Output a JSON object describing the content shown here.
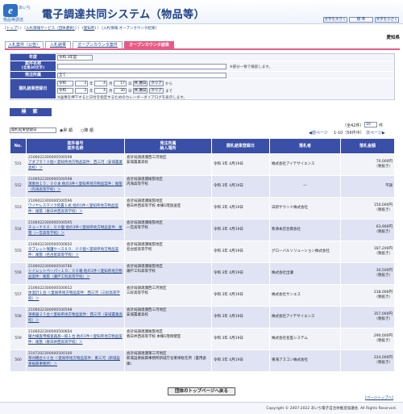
{
  "header": {
    "logo_letter": "e",
    "logo_small": "あいち",
    "logo_sub": "物品等調達",
    "title": "電子調達共同システム（物品等）",
    "btn_font_large": "文字を大きく",
    "btn_font_std": "標 準",
    "btn_font_small": "文字を小さく"
  },
  "breadcrumb": {
    "items": [
      "トップ",
      "入札情報サービス（団体選択）",
      "愛知県"
    ],
    "current": "入札情報:オープンカウンタ結果",
    "sep": "〉"
  },
  "org_name": "愛知県",
  "tabs": [
    "入札案件（公告）",
    "入札結果",
    "オープンカウンタ案件",
    "オープンカウンタ結果"
  ],
  "form": {
    "fiscal_year_label": "年度",
    "fiscal_year_value": "令和 3年度",
    "case_name_label": "案件名称",
    "case_name_sub": "(全角30文字)",
    "case_name_note": "※部分一致で検索します。",
    "order_org_label": "発注所属",
    "order_org_value": "全て",
    "date_label": "開札結果登録日",
    "era1": "令和",
    "from_y": "3",
    "from_m": "4",
    "from_d": "17",
    "to_y": "3",
    "to_m": "4",
    "to_d": "30",
    "unit_y": "年",
    "unit_m": "月",
    "unit_d": "日",
    "calendar": "共 暦日",
    "clear": "クリア",
    "from_suffix": "から",
    "to_suffix": "まで",
    "date_note": "※画像を押下すると日付を指定するためのカレンダーダイアログを表示します。"
  },
  "search_button": "検 索",
  "sort": {
    "select": "開札結果登録日",
    "asc": "昇 順",
    "desc": "降 順"
  },
  "paging": {
    "prev": "前ページ",
    "info": "（56件中）",
    "range": "1-10",
    "next": "次ページ",
    "per_page_label": "（全42件）",
    "per_page_value": "10",
    "per_page_unit": "件"
  },
  "table": {
    "headers": [
      "No.",
      "案件番号\n案件名称",
      "発注所属\n納入場所",
      "開札結果登録日",
      "落札者",
      "落札金額"
    ],
    "rows": [
      {
        "no": "551",
        "case_no": "2106022300000500598",
        "case_name": "アダプタ７０個＜愛知県地方物品案件：西三河（安城農業高校）＞",
        "org": "会計局調達課西三河地区",
        "place": "安城農業高校",
        "date": "令和 3年  4月19日",
        "winner": "株式会社アイテサイエンス",
        "amount": "70,000円",
        "tax": "（税抜き）"
      },
      {
        "no": "552",
        "case_no": "2106022300000500598",
        "case_name": "演奏台１５．００本 他の3件＜愛知県地方物品案件：尾張（内海高等学校）＞",
        "org": "会計局調達課尾張地区",
        "place": "内海高等学校",
        "date": "令和 3年  4月19日",
        "winner": "―",
        "amount": "不調",
        "tax": ""
      },
      {
        "no": "553",
        "case_no": "2106022300000500596",
        "case_name": "ワイヤレスマイク装置１式 他の1件＜愛知県地方物品案件：尾張（春日井西高等学校）＞",
        "org": "会計局調達課尾張地区",
        "place": "春日井西高等学校 本棟1階放送室",
        "date": "令和 3年  4月19日",
        "winner": "日新サウンド株式会社",
        "amount": "150,000円",
        "tax": "（税抜き）"
      },
      {
        "no": "554",
        "case_no": "2106022300000500595",
        "case_name": "チューナ６０．００個 他の3件＜愛知県地方物品案件：尾張（一宮高等学校）＞",
        "org": "会計局調達課尾張地区",
        "place": "一宮高等学校",
        "date": "令和 3年  4月19日",
        "winner": "和清本店合資会社",
        "amount": "63,900円",
        "tax": "（税抜き）"
      },
      {
        "no": "555",
        "case_no": "2106022300000500602",
        "case_name": "タブレット保護ケース６０．００個＜愛知県地方物品案件：尾張（名古屋高等学校）＞",
        "org": "会計局調達課尾張地区",
        "place": "名古屋高等学校",
        "date": "令和 3年  4月19日",
        "winner": "グローバルソリューション株式会社",
        "amount": "187,200円",
        "tax": "（税抜き）"
      },
      {
        "no": "556",
        "case_no": "2106022300000500786",
        "case_name": "トイレットペーパー１０．００箱 他の1件＜愛知県地方物品案件：尾張（瀬戸工科高等学校）＞",
        "org": "会計局調達課尾張地区",
        "place": "瀬戸工科高等学校",
        "date": "令和 3年  4月19日",
        "winner": "株式会社出瀬",
        "amount": "30,500円",
        "tax": "（税抜き）"
      },
      {
        "no": "557",
        "case_no": "2106022300000500652",
        "case_name": "体温計１台 ＜愛知県地方物品案件：西三河（三好高等学校）＞",
        "org": "会計局調達課西三河地区",
        "place": "三好高等学校",
        "date": "令和 3年  4月19日",
        "winner": "株式会社サンエス",
        "amount": "238,000円",
        "tax": "（税抜き）"
      },
      {
        "no": "558",
        "case_no": "2106022300000500598",
        "case_name": "演奏器２５台＜愛知県地方物品案件：西三河（安城農業高校）＞",
        "org": "会計局調達課西三河地区",
        "place": "安城農業高校",
        "date": "令和 3年  4月19日",
        "winner": "株式会社アイテサイエンス",
        "amount": "357,000円",
        "tax": "（税抜き）"
      },
      {
        "no": "559",
        "case_no": "2106022300000500604",
        "case_name": "聴力検査用検査器具一揃１台 他の1件＜愛知県地方物品案件：尾張（春日井西高等学校）＞",
        "org": "会計局調達課尾張地区",
        "place": "春日井西高等学校 本棟1階保健室",
        "date": "令和 3年  4月19日",
        "winner": "株式会社名医システム",
        "amount": "290,000円",
        "tax": "（税抜き）"
      },
      {
        "no": "560",
        "case_no": "2107202300000500100",
        "case_name": "草刈機台６０台 ＜愛知県地方物品案件：東三河（新城設楽振興事務所）＞",
        "org": "会計局調達課東三河地区",
        "place": "新城設楽振興事務所新城庁舎東栄駐在所（置用倉庫）",
        "date": "令和 3年  4月19日",
        "winner": "東海アスコン株式会社",
        "amount": "224,000円",
        "tax": "（税抜き）"
      }
    ]
  },
  "back_button": "団体のトップページへ戻る",
  "page_top": "ページトップへ",
  "copyright": "Copyright © 2007-2022 あいち電子自治体推進協議会. All Rights Reserved.",
  "colors": {
    "accent": "#3a4fa8",
    "tab_active": "#e85a86",
    "title": "#1a3f86",
    "row_odd": "#f2f3f8",
    "row_even": "#dfe3f3"
  }
}
